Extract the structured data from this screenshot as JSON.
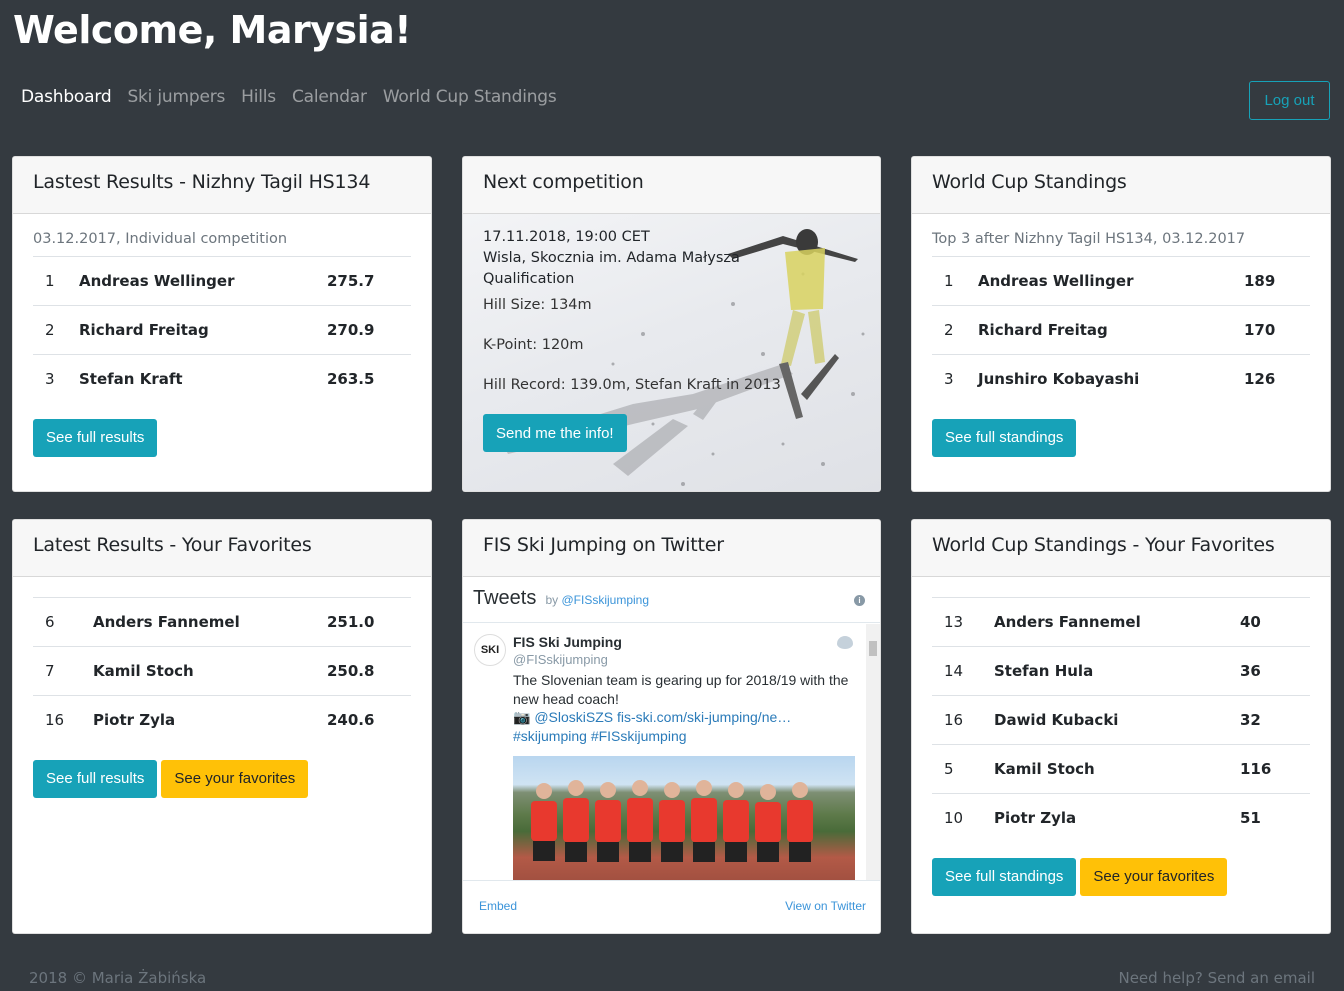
{
  "header": {
    "title": "Welcome, Marysia!"
  },
  "nav": {
    "items": [
      "Dashboard",
      "Ski jumpers",
      "Hills",
      "Calendar",
      "World Cup Standings"
    ],
    "active": "Dashboard",
    "logout": "Log out"
  },
  "latest_results": {
    "title": "Lastest Results - Nizhny Tagil HS134",
    "subtitle": "03.12.2017, Individual competition",
    "rows": [
      {
        "rank": "1",
        "name": "Andreas Wellinger",
        "points": "275.7"
      },
      {
        "rank": "2",
        "name": "Richard Freitag",
        "points": "270.9"
      },
      {
        "rank": "3",
        "name": "Stefan Kraft",
        "points": "263.5"
      }
    ],
    "button": "See full results"
  },
  "next_competition": {
    "title": "Next competition",
    "date": "17.11.2018, 19:00 CET",
    "venue": "Wisla, Skocznia im. Adama Małysza",
    "type": "Qualification",
    "hill_size": "Hill Size: 134m",
    "k_point": "K-Point: 120m",
    "hill_record": "Hill Record: 139.0m, Stefan Kraft in 2013",
    "button": "Send me the info!"
  },
  "standings": {
    "title": "World Cup Standings",
    "subtitle": "Top 3 after Nizhny Tagil HS134, 03.12.2017",
    "rows": [
      {
        "rank": "1",
        "name": "Andreas Wellinger",
        "points": "189"
      },
      {
        "rank": "2",
        "name": "Richard Freitag",
        "points": "170"
      },
      {
        "rank": "3",
        "name": "Junshiro Kobayashi",
        "points": "126"
      }
    ],
    "button": "See full standings"
  },
  "fav_results": {
    "title": "Latest Results - Your Favorites",
    "rows": [
      {
        "rank": "6",
        "name": "Anders Fannemel",
        "points": "251.0"
      },
      {
        "rank": "7",
        "name": "Kamil Stoch",
        "points": "250.8"
      },
      {
        "rank": "16",
        "name": "Piotr Zyla",
        "points": "240.6"
      }
    ],
    "button_results": "See full results",
    "button_favorites": "See your favorites"
  },
  "twitter": {
    "title": "FIS Ski Jumping on Twitter",
    "widget_title": "Tweets",
    "by": "by",
    "by_handle": "@FISskijumping",
    "info_icon": "i",
    "logo_text": "SKI",
    "author_name": "FIS Ski Jumping",
    "author_handle": "@FISskijumping",
    "tweet_text": "The Slovenian team is gearing up for 2018/19 with the new head coach!",
    "camera_icon": "📷",
    "tweet_link1": "@SloskiSZS fis-ski.com/ski-jumping/ne…",
    "tweet_tags": "#skijumping #FISskijumping",
    "embed": "Embed",
    "view_on_twitter": "View on Twitter"
  },
  "fav_standings": {
    "title": "World Cup Standings - Your Favorites",
    "rows": [
      {
        "rank": "13",
        "name": "Anders Fannemel",
        "points": "40"
      },
      {
        "rank": "14",
        "name": "Stefan Hula",
        "points": "36"
      },
      {
        "rank": "16",
        "name": "Dawid Kubacki",
        "points": "32"
      },
      {
        "rank": "5",
        "name": "Kamil Stoch",
        "points": "116"
      },
      {
        "rank": "10",
        "name": "Piotr Zyla",
        "points": "51"
      }
    ],
    "button_standings": "See full standings",
    "button_favorites": "See your favorites"
  },
  "footer": {
    "copyright": "2018 © Maria Żabińska",
    "help": "Need help? Send an email"
  },
  "colors": {
    "info": "#17a2b8",
    "warning": "#ffc107",
    "background": "#343a40"
  }
}
